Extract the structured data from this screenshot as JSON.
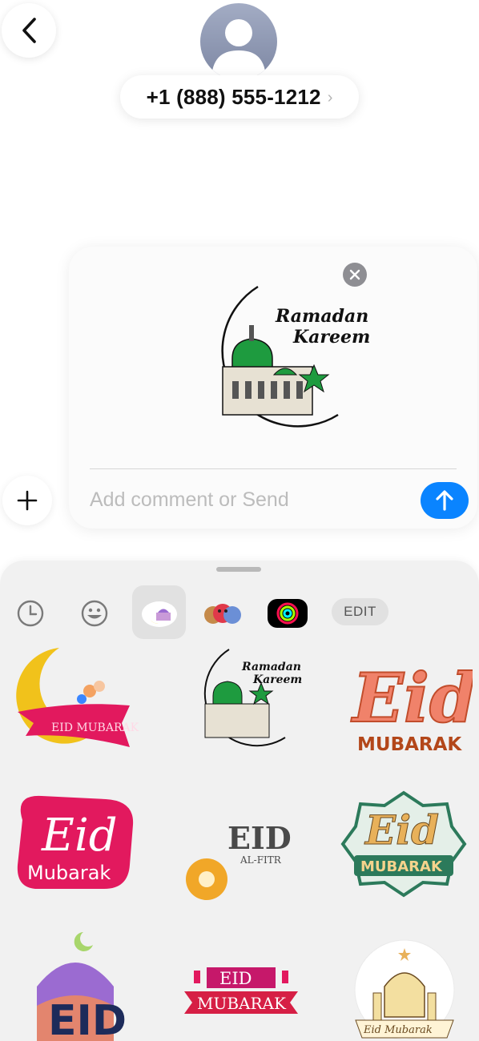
{
  "header": {
    "phone_number": "+1 (888) 555-1212",
    "back_icon": "chevron-left-icon",
    "avatar_icon": "person-icon"
  },
  "composer": {
    "placeholder": "Add comment or Send",
    "value": "",
    "attached_sticker": {
      "line1": "Ramadan",
      "line2": "Kareem"
    }
  },
  "drawer": {
    "tabs": [
      {
        "icon": "clock-icon"
      },
      {
        "icon": "smiley-icon"
      },
      {
        "icon": "eid-sticker-pack-icon",
        "selected": true
      },
      {
        "icon": "memoji-icon"
      },
      {
        "icon": "activity-rings-icon"
      }
    ],
    "edit_label": "EDIT"
  },
  "stickers": [
    {
      "text": "EID MUBARAK"
    },
    {
      "line1": "Ramadan",
      "line2": "Kareem"
    },
    {
      "line1": "Eid",
      "line2": "MUBARAK"
    },
    {
      "line1": "Eid",
      "line2": "Mubarak"
    },
    {
      "line1": "EID",
      "line2": "AL-FITR"
    },
    {
      "line1": "Eid",
      "line2": "MUBARAK"
    },
    {
      "line1": "EID"
    },
    {
      "line1": "EID",
      "line2": "MUBARAK"
    },
    {
      "line1": "Eid Mubarak"
    }
  ],
  "colors": {
    "accent_blue": "#0a84ff",
    "crescent_yellow": "#f5d10a",
    "dome_green": "#1e9b3f",
    "eid_pink": "#e2195e",
    "eid_orange": "#d97a1e"
  }
}
